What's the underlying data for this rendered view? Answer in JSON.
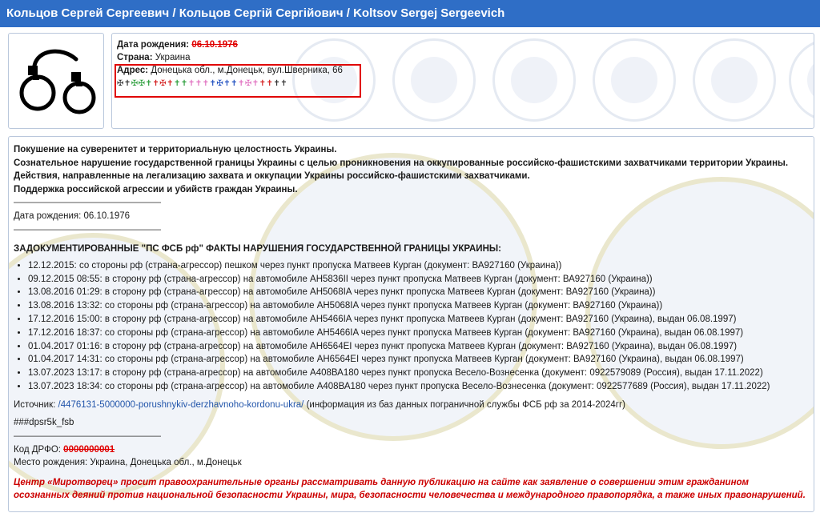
{
  "header": {
    "title": "Кольцов Сергей Сергеевич / Кольцов Сергій Сергійович / Koltsov Sergej Sergeevich"
  },
  "photo": {
    "icon": "handcuffs-icon"
  },
  "info": {
    "birth_label": "Дата рождения:",
    "birth_value": "06.10.1976",
    "country_label": "Страна:",
    "country_value": "Украина",
    "address_label": "Адрес:",
    "address_value": "Донецька обл., м.Донецьк, вул.Шверника, 66",
    "crosses": "✠✝✠✠✝✝✠✝✝✝✝✝✝✝✠✝✝✝✝✠✝✝✝✝"
  },
  "main": {
    "crimes": [
      "Покушение на суверенитет и территориальную целостность Украины.",
      "Сознательное нарушение государственной границы Украины с целью проникновения на оккупированные российско-фашистскими захватчиками территории Украины.",
      "Действия, направленные на легализацию захвата и оккупации Украины российско-фашистскими захватчиками.",
      "Поддержка российской агрессии и убийств граждан Украины."
    ],
    "separator": "————————————————",
    "birth_line": "Дата рождения: 06.10.1976",
    "facts_heading": "ЗАДОКУМЕНТИРОВАННЫЕ \"ПС ФСБ рф\" ФАКТЫ НАРУШЕНИЯ ГОСУДАРСТВЕННОЙ ГРАНИЦЫ УКРАИНЫ:",
    "violations": [
      "12.12.2015: со стороны рф (страна-агрессор) пешком через пункт пропуска Матвеев Курган (документ: ВА927160 (Украина))",
      "09.12.2015 08:55: в сторону рф (страна-агрессор) на автомобиле АН5836II через пункт пропуска Матвеев Курган (документ: ВА927160 (Украина))",
      "13.08.2016 01:29: в сторону рф (страна-агрессор) на автомобиле АН5068IA через пункт пропуска Матвеев Курган (документ: ВА927160 (Украина))",
      "13.08.2016 13:32: со стороны рф (страна-агрессор) на автомобиле АН5068IA через пункт пропуска Матвеев Курган (документ: ВА927160 (Украина))",
      "17.12.2016 15:00: в сторону рф (страна-агрессор) на автомобиле АН5466IA через пункт пропуска Матвеев Курган (документ: ВА927160 (Украина), выдан 06.08.1997)",
      "17.12.2016 18:37: со стороны рф (страна-агрессор) на автомобиле АН5466IA через пункт пропуска Матвеев Курган (документ: ВА927160 (Украина), выдан 06.08.1997)",
      "01.04.2017 01:16: в сторону рф (страна-агрессор) на автомобиле АН6564EI через пункт пропуска Матвеев Курган (документ: ВА927160 (Украина), выдан 06.08.1997)",
      "01.04.2017 14:31: со стороны рф (страна-агрессор) на автомобиле АН6564EI через пункт пропуска Матвеев Курган (документ: ВА927160 (Украина), выдан 06.08.1997)",
      "13.07.2023 13:17: в сторону рф (страна-агрессор) на автомобиле А408ВА180 через пункт пропуска Весело-Вознесенка (документ: 0922579089 (Россия), выдан 17.11.2022)",
      "13.07.2023 18:34: со стороны рф (страна-агрессор) на автомобиле А408ВА180 через пункт пропуска Весело-Вознесенка (документ: 0922577689 (Россия), выдан 17.11.2022)"
    ],
    "source_label": "Источник:",
    "source_link": "/4476131-5000000-porushnykiv-derzhavnoho-kordonu-ukra/",
    "source_note": "(информация из баз данных пограничной службы ФСБ рф за 2014-2024гг)",
    "tag": "###dpsr5k_fsb",
    "drfo_label": "Код ДРФО:",
    "drfo_value": "0000000001",
    "birthplace": "Место рождения: Украина, Донецька обл., м.Донецьк",
    "appeal": "Центр «Миротворец» просит правоохранительные органы рассматривать данную публикацию на сайте как заявление о совершении этим гражданином осознанных деяний против национальной безопасности Украины, мира, безопасности человечества и международного правопорядка, а также иных правонарушений."
  },
  "colors": {
    "header_bg": "#2f6ec6",
    "alert_red": "#e00000",
    "link": "#2255aa"
  }
}
